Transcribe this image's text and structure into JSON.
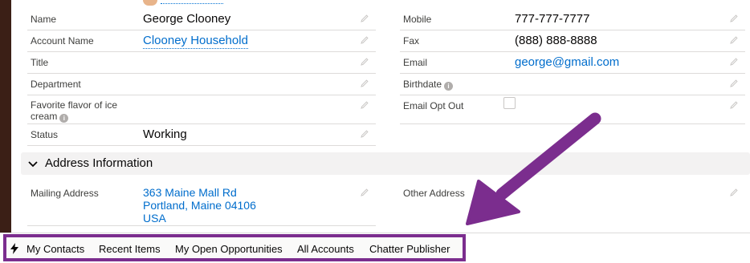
{
  "details": {
    "left": [
      {
        "label": "Name",
        "value": "George Clooney"
      },
      {
        "label": "Account Name",
        "value": "Clooney Household"
      },
      {
        "label": "Title",
        "value": ""
      },
      {
        "label": "Department",
        "value": ""
      },
      {
        "label_line1": "Favorite flavor of ice",
        "label_line2": "cream"
      },
      {
        "label": "Status",
        "value": "Working"
      }
    ],
    "right": [
      {
        "label": "Mobile",
        "value": "777-777-7777"
      },
      {
        "label": "Fax",
        "value": "(888) 888-8888"
      },
      {
        "label": "Email",
        "value": "george@gmail.com"
      },
      {
        "label": "Birthdate",
        "value": ""
      },
      {
        "label": "Email Opt Out",
        "value": ""
      }
    ]
  },
  "address_section": {
    "title": "Address Information",
    "mailing_label": "Mailing Address",
    "mailing_line1": "363 Maine Mall Rd",
    "mailing_line2": "Portland, Maine 04106",
    "mailing_line3": "USA",
    "other_label": "Other Address"
  },
  "utility_bar": {
    "items": [
      "My Contacts",
      "Recent Items",
      "My Open Opportunities",
      "All Accounts",
      "Chatter Publisher"
    ]
  },
  "colors": {
    "highlight": "#7b2d8e",
    "link": "#006dcc"
  },
  "icons": {
    "edit": "pencil-icon",
    "info": "info-icon",
    "chevron": "chevron-down-icon",
    "utility": "bolt-icon"
  }
}
